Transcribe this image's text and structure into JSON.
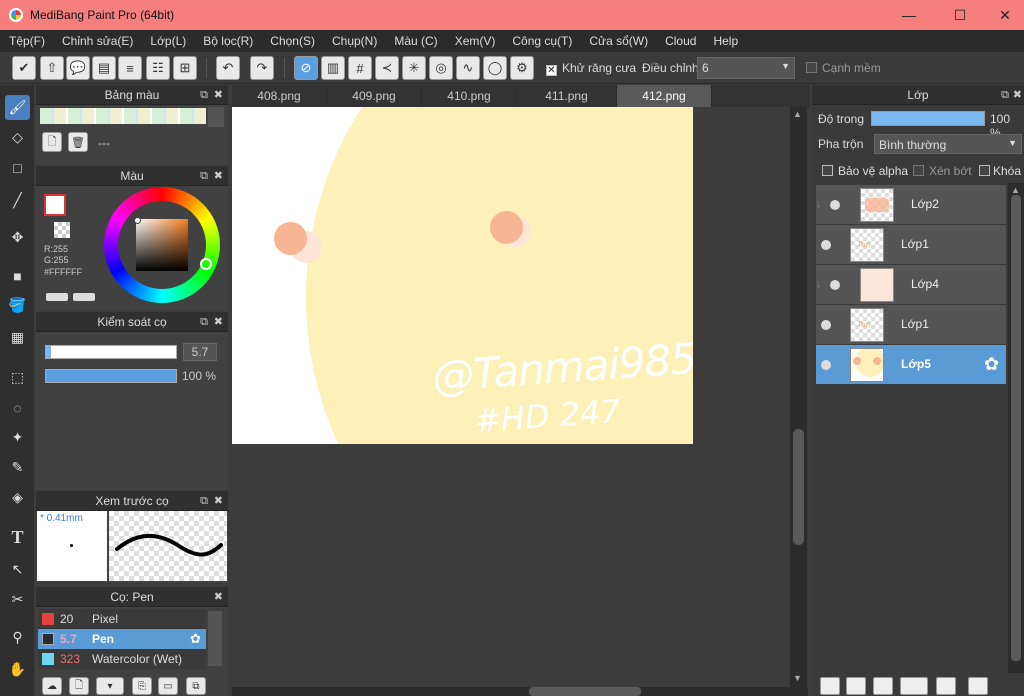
{
  "window": {
    "title": "MediBang Paint Pro (64bit)",
    "minimize": "—",
    "maximize": "☐",
    "close": "✕"
  },
  "menu": [
    "Tệp(F)",
    "Chỉnh sửa(E)",
    "Lớp(L)",
    "Bộ lọc(R)",
    "Chọn(S)",
    "Chụp(N)",
    "Màu (C)",
    "Xem(V)",
    "Công cụ(T)",
    "Cửa sổ(W)",
    "Cloud",
    "Help"
  ],
  "toolbar": {
    "antialias_label": "Khử răng cưa",
    "correction_label": "Điều chỉnh",
    "correction_value": "6",
    "soft_edge_label": "Cạnh mềm"
  },
  "palette_panel": {
    "title": "Bảng màu",
    "name": "---"
  },
  "color_panel": {
    "title": "Màu",
    "r": "R:255",
    "g": "G:255",
    "hex": "#FFFFFF",
    "foreground": "#ffffff",
    "background": "#ffffff"
  },
  "brush_control": {
    "title": "Kiểm soát cọ",
    "size": "5.7",
    "opacity": "100 %",
    "size_fraction": 0.04,
    "opacity_fraction": 1.0
  },
  "brush_preview": {
    "title": "Xem trước cọ",
    "size_label": "* 0.41mm"
  },
  "brush_list": {
    "title": "Cọ: Pen",
    "items": [
      {
        "size": "20",
        "name": "Pixel",
        "color": "#e84040"
      },
      {
        "size": "5.7",
        "name": "Pen",
        "color": "#2b2b2b"
      },
      {
        "size": "323",
        "name": "Watercolor (Wet)",
        "color": "#6fd8f0"
      }
    ]
  },
  "tabs": [
    "408.png",
    "409.png",
    "410.png",
    "411.png",
    "412.png"
  ],
  "canvas": {
    "watermark_line1": "@Tanmai985",
    "watermark_line2": "#HD 247"
  },
  "layers_panel": {
    "title": "Lớp",
    "opacity_label": "Độ trong",
    "opacity_value": "100 %",
    "opacity_fraction": 1.0,
    "blend_label": "Pha trộn",
    "blend_value": "Bình thường",
    "protect_alpha": "Bảo vệ alpha",
    "clip": "Xén bớt",
    "lock": "Khóa",
    "layers": [
      {
        "name": "Lớp2",
        "clipped": true
      },
      {
        "name": "Lớp1",
        "clipped": false
      },
      {
        "name": "Lớp4",
        "clipped": true
      },
      {
        "name": "Lớp1",
        "clipped": false
      },
      {
        "name": "Lớp5",
        "clipped": false,
        "selected": true
      }
    ]
  }
}
